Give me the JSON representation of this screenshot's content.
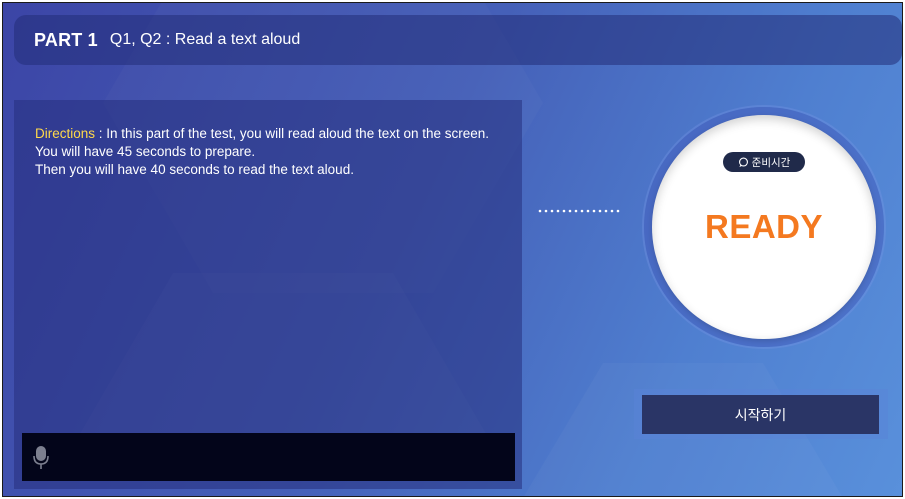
{
  "header": {
    "part_label": "PART 1",
    "title": "Q1, Q2 : Read a text aloud"
  },
  "directions": {
    "label": "Directions",
    "separator": " : ",
    "lines": [
      "In this part of the test, you will read aloud the text on the screen.",
      "You will have 45 seconds to prepare.",
      "Then you will have 40 seconds to read the text aloud."
    ]
  },
  "timer": {
    "badge_label": "준비시간",
    "status": "READY"
  },
  "start_button": {
    "label": "시작하기"
  },
  "icons": {
    "mic": "microphone-icon",
    "badge": "chat-bubble-icon"
  },
  "colors": {
    "status_text": "#f47920",
    "directions_label": "#ffd94a",
    "button_bg": "#2a3566",
    "mic_bar_bg": "#03051a"
  }
}
